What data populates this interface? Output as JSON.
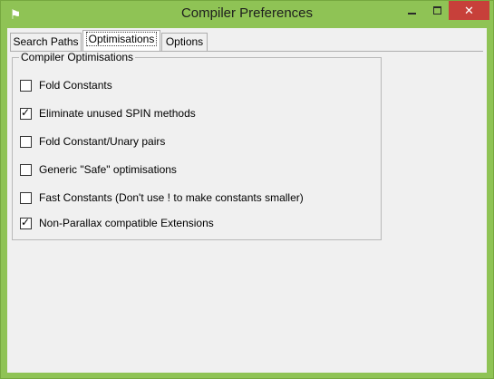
{
  "window": {
    "title": "Compiler Preferences",
    "icon": "spin-app-icon",
    "minimize_icon": "minimize-icon",
    "maximize_icon": "maximize-icon",
    "close_icon": "close-icon",
    "close_symbol": "✕",
    "accent_color": "#8fc355",
    "close_color": "#c7403a"
  },
  "tabs": [
    {
      "label": "Search Paths",
      "selected": false
    },
    {
      "label": "Optimisations",
      "selected": true
    },
    {
      "label": "Options",
      "selected": false
    }
  ],
  "group": {
    "title": "Compiler Optimisations",
    "options": [
      {
        "label": "Fold Constants",
        "checked": false
      },
      {
        "label": "Eliminate unused SPIN methods",
        "checked": true
      },
      {
        "label": "Fold Constant/Unary pairs",
        "checked": false
      },
      {
        "label": "Generic \"Safe\" optimisations",
        "checked": false
      },
      {
        "label": "Fast Constants (Don't use ! to make constants smaller)",
        "checked": false
      },
      {
        "label": "Non-Parallax compatible Extensions",
        "checked": true
      }
    ]
  }
}
